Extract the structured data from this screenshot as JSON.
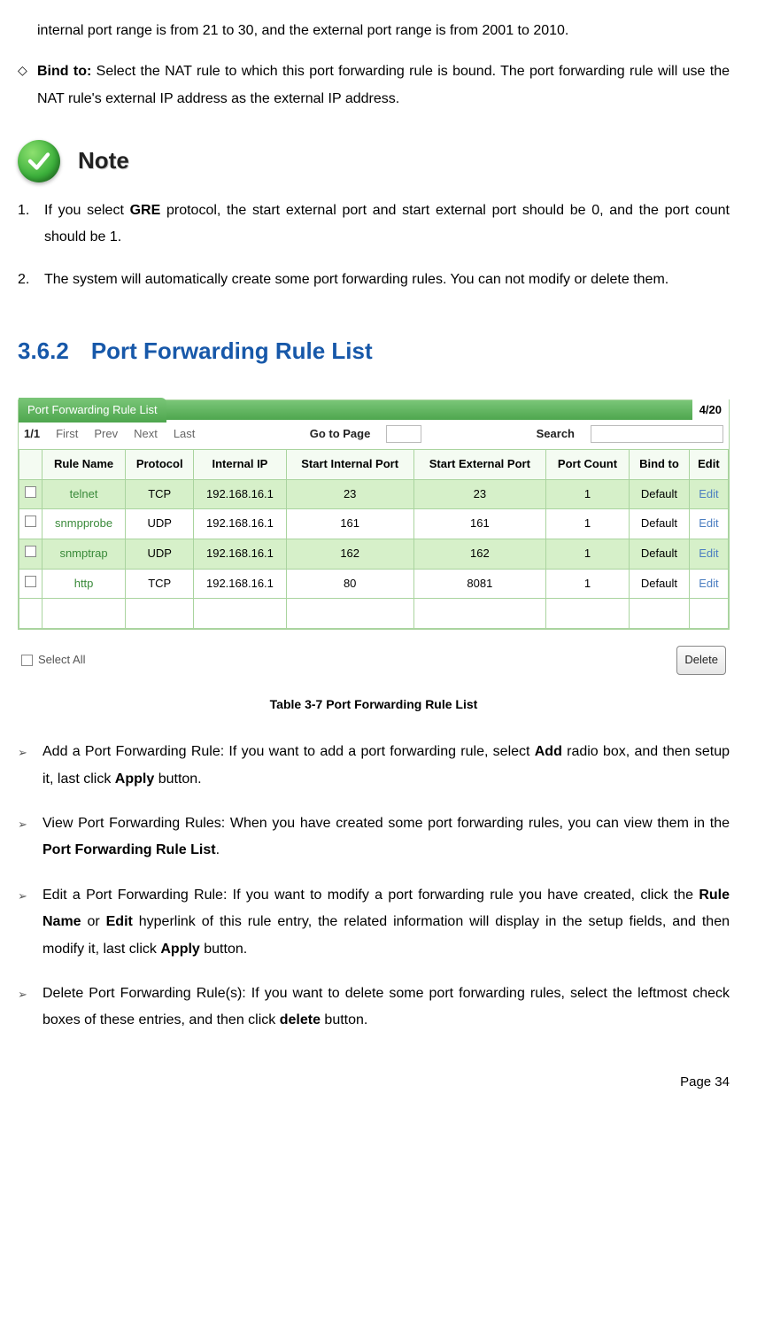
{
  "top_para": "internal port range is from 21 to 30, and the external port range is from 2001 to 2010.",
  "diamond": {
    "label": "Bind to:",
    "text": " Select the NAT rule to which this port forwarding rule is bound. The port forwarding rule will use the NAT rule's external IP address as the external IP address."
  },
  "note_label": "Note",
  "notes": [
    {
      "num": "1.",
      "pre": "If you select ",
      "bold": "GRE",
      "post": " protocol, the start external port and start external port should be 0, and the port count should be 1."
    },
    {
      "num": "2.",
      "pre": "The system will automatically create some port forwarding rules. You can not modify or delete them.",
      "bold": "",
      "post": ""
    }
  ],
  "section": {
    "num": "3.6.2",
    "title": "Port Forwarding Rule List"
  },
  "table": {
    "title": "Port Forwarding Rule List",
    "count": "4/20",
    "nav": {
      "page": "1/1",
      "first": "First",
      "prev": "Prev",
      "next": "Next",
      "last": "Last",
      "goto": "Go to Page",
      "search": "Search"
    },
    "headers": [
      "",
      "Rule Name",
      "Protocol",
      "Internal IP",
      "Start Internal Port",
      "Start External Port",
      "Port Count",
      "Bind to",
      "Edit"
    ],
    "rows": [
      {
        "name": "telnet",
        "proto": "TCP",
        "ip": "192.168.16.1",
        "sip": "23",
        "sep": "23",
        "pc": "1",
        "bind": "Default",
        "edit": "Edit",
        "hl": true
      },
      {
        "name": "snmpprobe",
        "proto": "UDP",
        "ip": "192.168.16.1",
        "sip": "161",
        "sep": "161",
        "pc": "1",
        "bind": "Default",
        "edit": "Edit",
        "hl": false
      },
      {
        "name": "snmptrap",
        "proto": "UDP",
        "ip": "192.168.16.1",
        "sip": "162",
        "sep": "162",
        "pc": "1",
        "bind": "Default",
        "edit": "Edit",
        "hl": true
      },
      {
        "name": "http",
        "proto": "TCP",
        "ip": "192.168.16.1",
        "sip": "80",
        "sep": "8081",
        "pc": "1",
        "bind": "Default",
        "edit": "Edit",
        "hl": false
      }
    ],
    "select_all": "Select All",
    "delete": "Delete"
  },
  "caption": "Table 3-7 Port Forwarding Rule List",
  "arrows": [
    {
      "parts": [
        {
          "t": "Add a Port Forwarding Rule: If you want to add a port forwarding rule, select "
        },
        {
          "t": "Add",
          "b": true
        },
        {
          "t": " radio box, and then setup it, last click "
        },
        {
          "t": "Apply",
          "b": true
        },
        {
          "t": " button."
        }
      ]
    },
    {
      "parts": [
        {
          "t": "View Port Forwarding Rules: When you have created some port forwarding rules, you can view them in the "
        },
        {
          "t": "Port Forwarding Rule List",
          "b": true
        },
        {
          "t": "."
        }
      ]
    },
    {
      "parts": [
        {
          "t": "Edit a Port Forwarding Rule: If you want to modify a port forwarding rule you have created, click the "
        },
        {
          "t": "Rule Name",
          "b": true
        },
        {
          "t": " or "
        },
        {
          "t": "Edit",
          "b": true
        },
        {
          "t": " hyperlink of this rule entry, the related information will display in the setup fields, and then modify it, last click "
        },
        {
          "t": "Apply",
          "b": true
        },
        {
          "t": " button."
        }
      ]
    },
    {
      "parts": [
        {
          "t": "Delete Port Forwarding Rule(s): If you want to delete some port forwarding rules, select the leftmost check boxes of these entries, and then click "
        },
        {
          "t": "delete",
          "b": true
        },
        {
          "t": " button."
        }
      ]
    }
  ],
  "footer": "Page  34"
}
